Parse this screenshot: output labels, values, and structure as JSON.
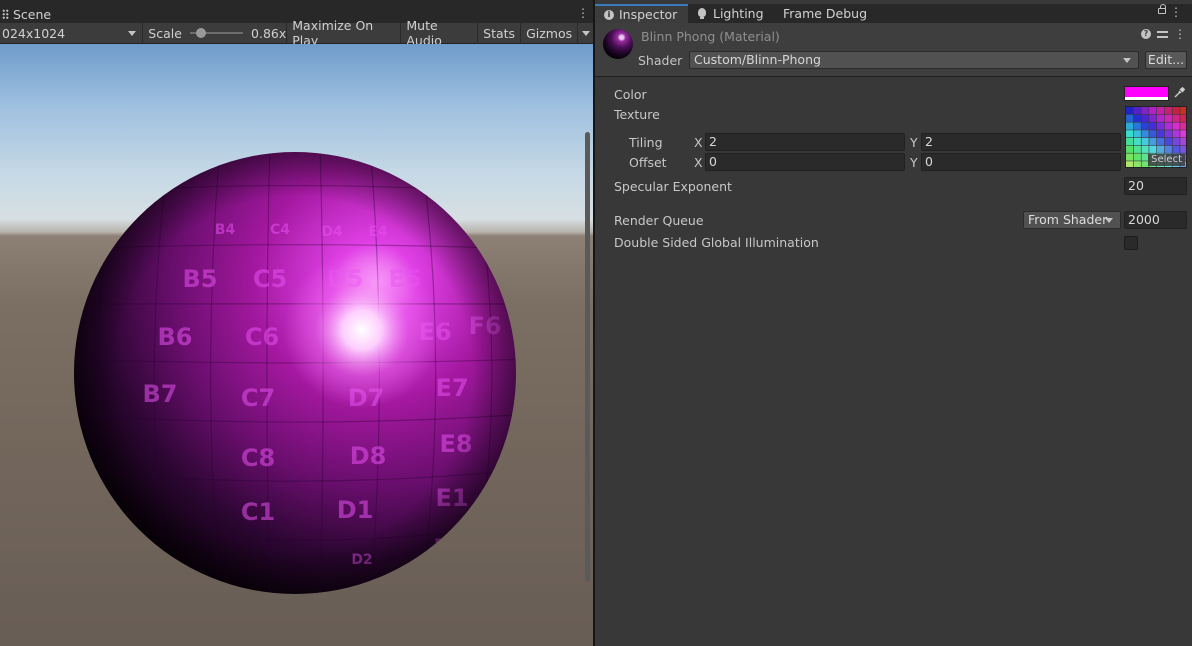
{
  "scene": {
    "tab_label": "Scene",
    "resolution": "024x1024",
    "scale_label": "Scale",
    "scale_value": "0.86x",
    "scale_fraction": 0.12,
    "buttons": [
      "Maximize On Play",
      "Mute Audio",
      "Stats",
      "Gizmos"
    ],
    "sphere_tiles": [
      "B5",
      "C5",
      "D5",
      "E5",
      "B6",
      "C6",
      "E6",
      "F6",
      "B7",
      "C7",
      "D7",
      "E7",
      "C8",
      "D8",
      "E8",
      "C1",
      "D1",
      "E1",
      "D2",
      "E2",
      "C4",
      "D4",
      "E4",
      "B4"
    ]
  },
  "inspector": {
    "tabs": [
      "Inspector",
      "Lighting",
      "Frame Debug"
    ],
    "material_title": "Blinn Phong (Material)",
    "shader_label": "Shader",
    "shader_value": "Custom/Blinn-Phong",
    "edit_label": "Edit...",
    "properties": {
      "color_label": "Color",
      "color_value": "#ff00ff",
      "texture_label": "Texture",
      "texture_select": "Select",
      "tiling_label": "Tiling",
      "tiling_x": "2",
      "tiling_y": "2",
      "offset_label": "Offset",
      "offset_x": "0",
      "offset_y": "0",
      "x_axis": "X",
      "y_axis": "Y",
      "specular_label": "Specular Exponent",
      "specular_value": "20",
      "render_queue_label": "Render Queue",
      "render_queue_mode": "From Shader",
      "render_queue_value": "2000",
      "double_sided_label": "Double Sided Global Illumination",
      "double_sided_checked": false
    }
  },
  "colors": {
    "accent": "#3a79bb",
    "material_color": "#ff00ff",
    "panel": "#383838"
  }
}
